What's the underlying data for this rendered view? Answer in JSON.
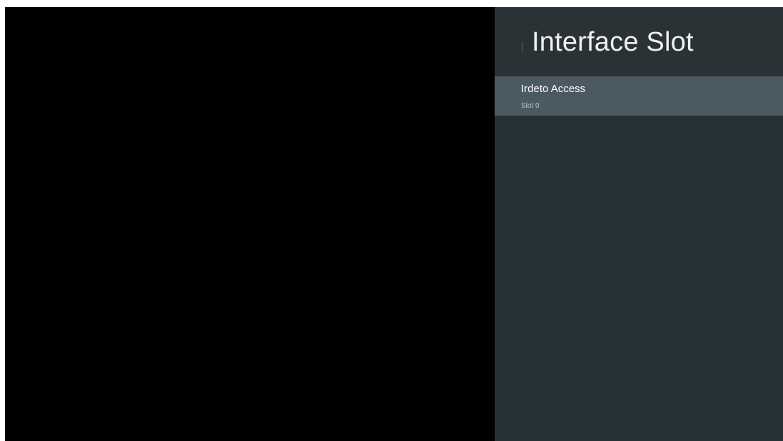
{
  "panel": {
    "title": "Interface Slot",
    "items": [
      {
        "title": "Irdeto Access",
        "subtitle": "Slot 0"
      }
    ]
  },
  "colors": {
    "video_background": "#000000",
    "panel_background": "#263238",
    "header_background": "#2b3236",
    "selected_item_background": "#4b5a61"
  }
}
